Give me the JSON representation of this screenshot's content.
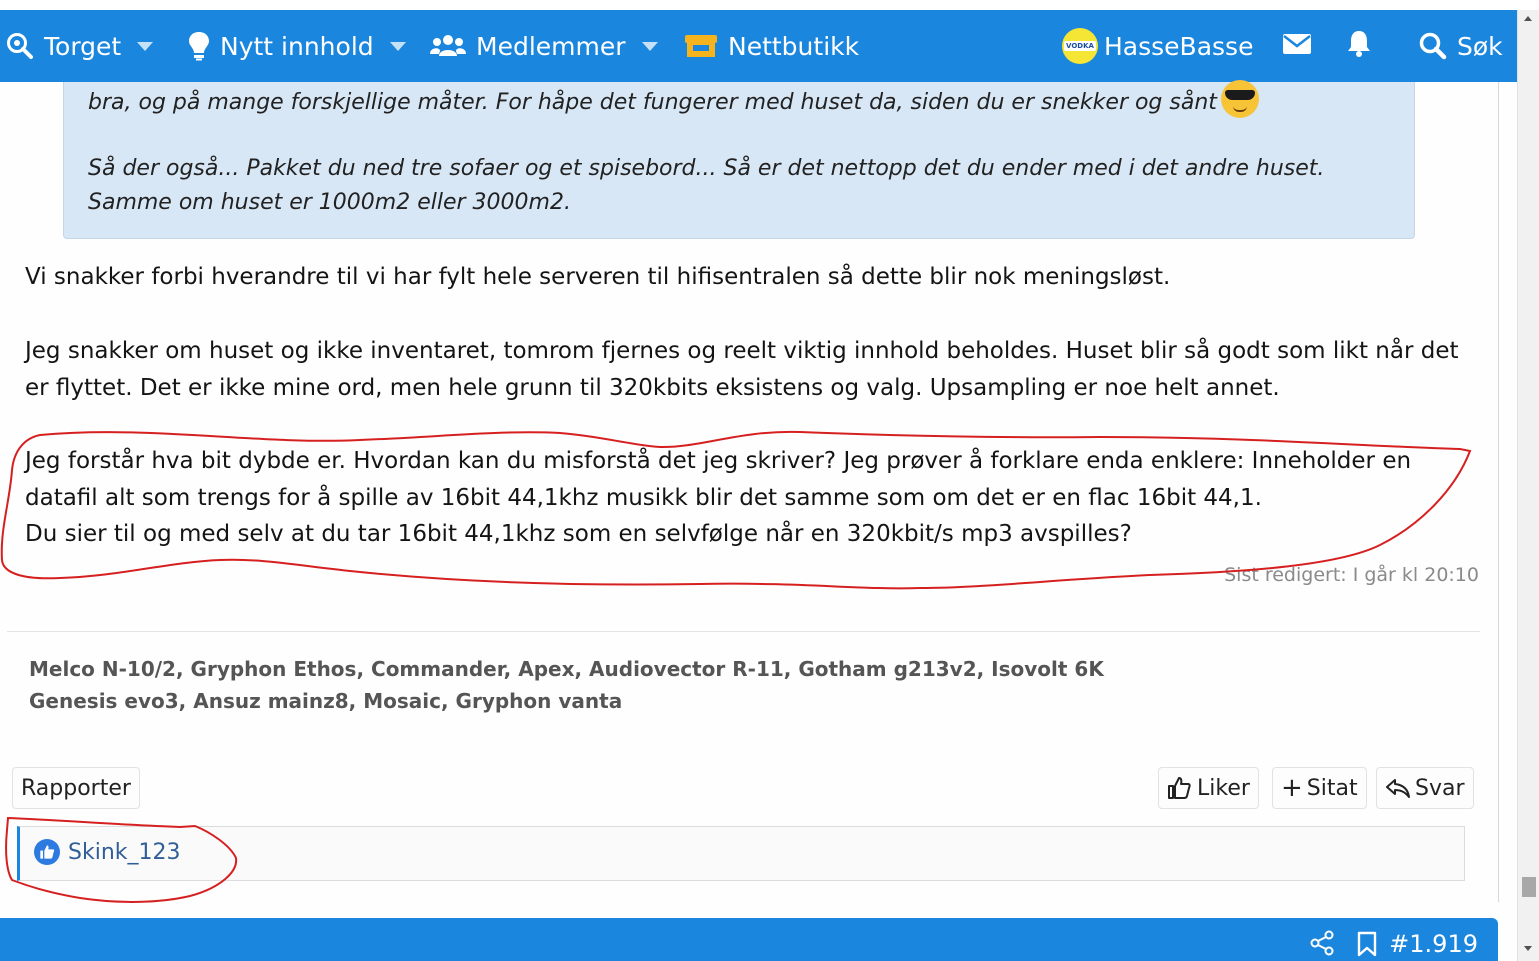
{
  "nav": {
    "torget": "Torget",
    "nytt_innhold": "Nytt innhold",
    "medlemmer": "Medlemmer",
    "nettbutikk": "Nettbutikk",
    "username": "HasseBasse",
    "avatar_text": "VODKA",
    "search": "Søk"
  },
  "quote": {
    "line1": "bra, og på mange forskjellige måter. For håpe det fungerer med huset da, siden du er snekker og sånt",
    "para2": "Så der også... Pakket du ned tre sofaer og et spisebord... Så er det nettopp det du ender med i det andre huset. Samme om huset er 1000m2 eller 3000m2."
  },
  "post": {
    "p1": "Vi snakker forbi hverandre til vi har fylt hele serveren til hifisentralen så dette blir nok meningsløst.",
    "p2": "Jeg snakker om huset og ikke inventaret, tomrom fjernes og reelt viktig innhold beholdes. Huset blir så godt som likt når det er flyttet. Det er ikke mine ord, men hele grunn til 320kbits eksistens og valg. Upsampling er noe helt annet.",
    "p3": "Jeg forstår hva bit dybde er. Hvordan kan du misforstå det jeg skriver? Jeg prøver å forklare enda enklere: Inneholder en datafil alt som trengs for å spille av 16bit 44,1khz musikk blir det samme som om det er en flac 16bit 44,1.",
    "p4": "Du sier til og med selv at du tar 16bit 44,1khz som en selvfølge når en 320kbit/s mp3 avspilles?",
    "edited": "Sist redigert: I går kl 20:10"
  },
  "signature": {
    "line1": "Melco N-10/2, Gryphon Ethos, Commander, Apex, Audiovector R-11, Gotham g213v2, Isovolt 6K",
    "line2": "Genesis evo3, Ansuz mainz8, Mosaic, Gryphon vanta"
  },
  "actions": {
    "report": "Rapporter",
    "like": "Liker",
    "quote": "Sitat",
    "reply": "Svar"
  },
  "likes": {
    "user": "Skink_123"
  },
  "footer": {
    "post_number": "#1.919"
  },
  "colors": {
    "brand": "#1b86de",
    "quote_bg": "#d8e7f5",
    "annotation": "#d62020"
  }
}
